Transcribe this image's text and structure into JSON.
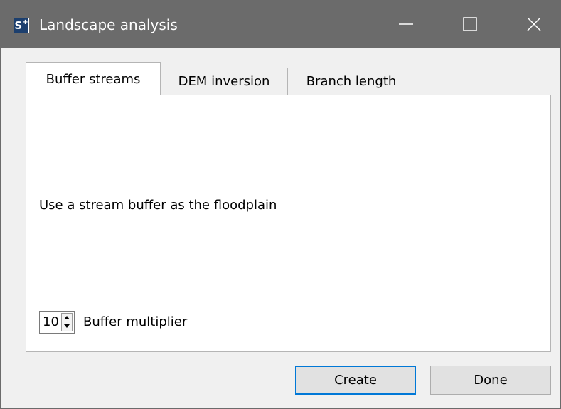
{
  "window": {
    "title": "Landscape analysis",
    "app_icon_text": "S",
    "app_icon_sup": "+",
    "controls": [
      "minimize-icon",
      "maximize-icon",
      "close-icon"
    ]
  },
  "tabs": [
    {
      "label": "Buffer streams",
      "active": true
    },
    {
      "label": "DEM inversion",
      "active": false
    },
    {
      "label": "Branch length",
      "active": false
    }
  ],
  "panel": {
    "description": "Use a stream buffer as the floodplain",
    "buffer_multiplier": {
      "value": "10",
      "label": "Buffer multiplier"
    }
  },
  "buttons": {
    "create": "Create",
    "done": "Done"
  },
  "colors": {
    "titlebar": "#6b6b6b",
    "app_icon": "#1c3f6e",
    "focus_border": "#0078d7",
    "window_bg": "#f0f0f0"
  }
}
